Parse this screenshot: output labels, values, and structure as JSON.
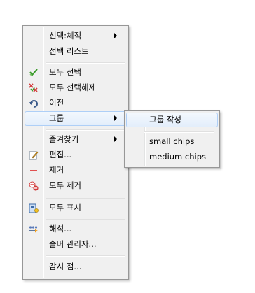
{
  "context_menu": {
    "items": [
      {
        "label": "선택:체적",
        "submenu": true
      },
      {
        "label": "선택 리스트"
      },
      {
        "label": "모두 선택",
        "icon": "check-icon"
      },
      {
        "label": "모두 선택해제",
        "icon": "clear-selection-icon"
      },
      {
        "label": "이전",
        "icon": "undo-icon"
      },
      {
        "label": "그룹",
        "submenu": true,
        "highlighted": true
      },
      {
        "label": "즐겨찾기",
        "submenu": true
      },
      {
        "label": "편집...",
        "icon": "edit-icon"
      },
      {
        "label": "제거",
        "icon": "remove-icon"
      },
      {
        "label": "모두 제거",
        "icon": "remove-all-icon"
      },
      {
        "label": "모두 표시",
        "icon": "display-all-icon"
      },
      {
        "label": "해석...",
        "icon": "analyze-icon"
      },
      {
        "label": "솔버 관리자...",
        "icon": ""
      },
      {
        "label": "감시 점..."
      }
    ]
  },
  "group_submenu": {
    "items": [
      {
        "label": "그룹 작성",
        "highlighted": true
      },
      {
        "label": "small chips"
      },
      {
        "label": "medium chips"
      }
    ]
  },
  "colors": {
    "menu_bg": "#f0f0f0",
    "highlight_border": "#aecff7",
    "check_green": "#3a9a2a",
    "remove_red": "#d23a3a"
  }
}
